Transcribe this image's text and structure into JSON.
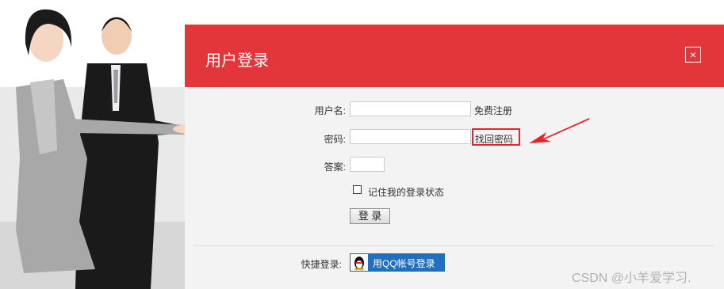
{
  "dialog": {
    "title": "用户登录",
    "close_glyph": "×"
  },
  "form": {
    "username_label": "用户名:",
    "username_value": "",
    "register_link": "免费注册",
    "password_label": "密码:",
    "password_value": "",
    "recover_link": "找回密码",
    "answer_label": "答案:",
    "answer_value": "",
    "remember_label": "记住我的登录状态",
    "remember_checked": false,
    "submit_label": "登 录"
  },
  "quick_login": {
    "label": "快捷登录:",
    "qq_button": "用QQ帐号登录"
  },
  "watermark": "CSDN @小羊爱学习.",
  "colors": {
    "header": "#e2363a",
    "annotation": "#e2262b",
    "qq_button": "#2270bb"
  },
  "icons": [
    "close-icon",
    "qq-penguin-icon",
    "annotation-arrow-icon"
  ]
}
